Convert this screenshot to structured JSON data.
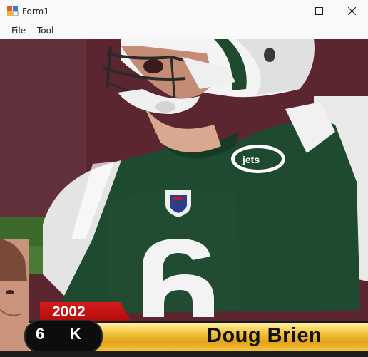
{
  "window": {
    "title": "Form1",
    "controls": [
      "minimize",
      "maximize",
      "close"
    ]
  },
  "menu": {
    "items": [
      "File",
      "Tool"
    ]
  },
  "picture": {
    "description_icon": "football-player-photo",
    "overlay": {
      "year": "2002",
      "number": "6",
      "position": "K",
      "name": "Doug Brien"
    }
  },
  "colors": {
    "jersey_green": "#1f4a2e",
    "overlay_red": "#c51414",
    "overlay_gold": "#f0c23a"
  }
}
